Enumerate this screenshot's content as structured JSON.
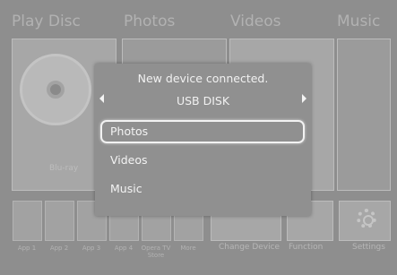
{
  "background": {
    "sections": [
      "Play Disc",
      "Photos",
      "Videos",
      "Music"
    ],
    "disc_label": "Blu-ray",
    "apps": [
      "App 1",
      "App 2",
      "App 3",
      "App 4",
      "Opera TV Store",
      "More"
    ],
    "bottom_items": [
      "Change Device",
      "Function",
      "Settings"
    ]
  },
  "dialog": {
    "title": "New device connected.",
    "device": "USB DISK",
    "options": [
      "Photos",
      "Videos",
      "Music"
    ],
    "selected_index": 0
  }
}
